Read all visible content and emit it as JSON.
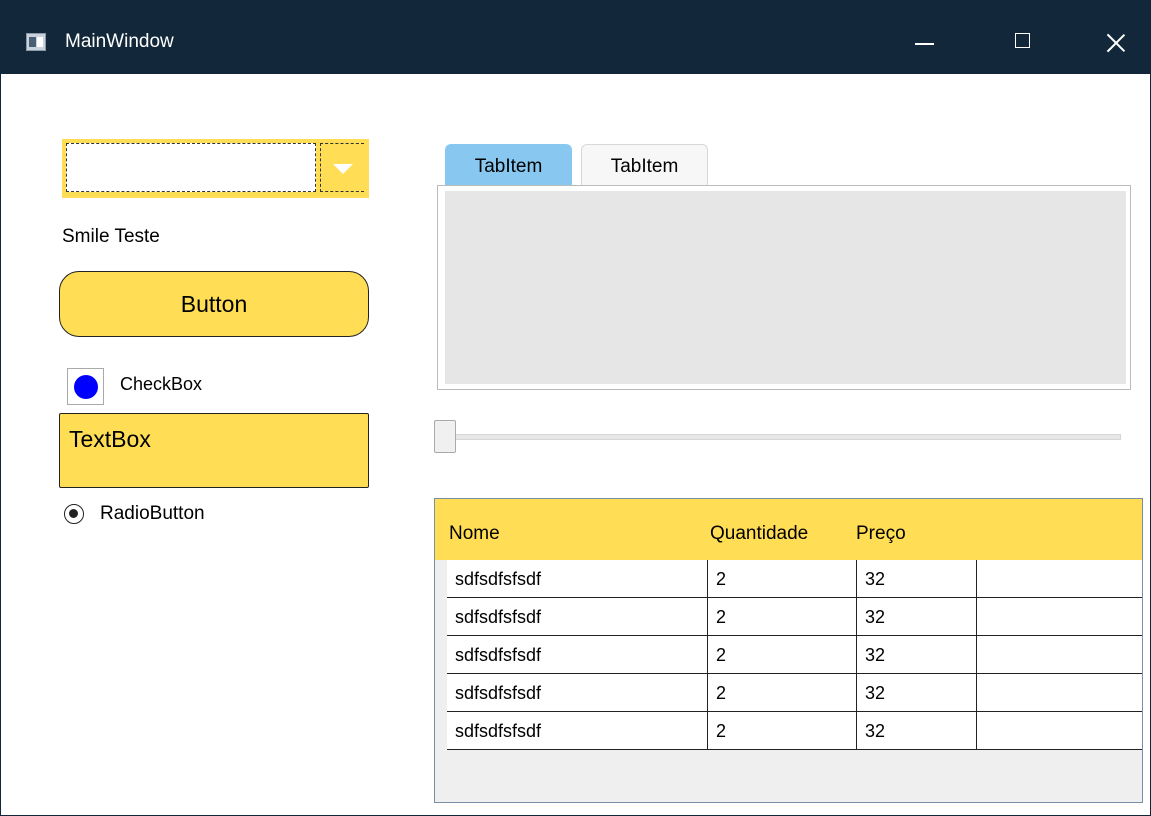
{
  "window": {
    "title": "MainWindow"
  },
  "left_panel": {
    "combobox_value": "",
    "label": "Smile Teste",
    "button_label": "Button",
    "checkbox_label": "CheckBox",
    "textbox_value": "TextBox",
    "radio_label": "RadioButton"
  },
  "tabs": [
    {
      "label": "TabItem",
      "selected": true
    },
    {
      "label": "TabItem",
      "selected": false
    }
  ],
  "slider": {
    "value": 0
  },
  "grid": {
    "columns": [
      "Nome",
      "Quantidade",
      "Preço"
    ],
    "rows": [
      [
        "sdfsdfsfsdf",
        "2",
        "32"
      ],
      [
        "sdfsdfsfsdf",
        "2",
        "32"
      ],
      [
        "sdfsdfsfsdf",
        "2",
        "32"
      ],
      [
        "sdfsdfsfsdf",
        "2",
        "32"
      ],
      [
        "sdfsdfsfsdf",
        "2",
        "32"
      ]
    ]
  },
  "colors": {
    "titlebar": "#12283a",
    "accent_yellow": "#ffdd55",
    "tab_selected": "#88c8f0",
    "checkbox_fill": "#0000ff"
  }
}
